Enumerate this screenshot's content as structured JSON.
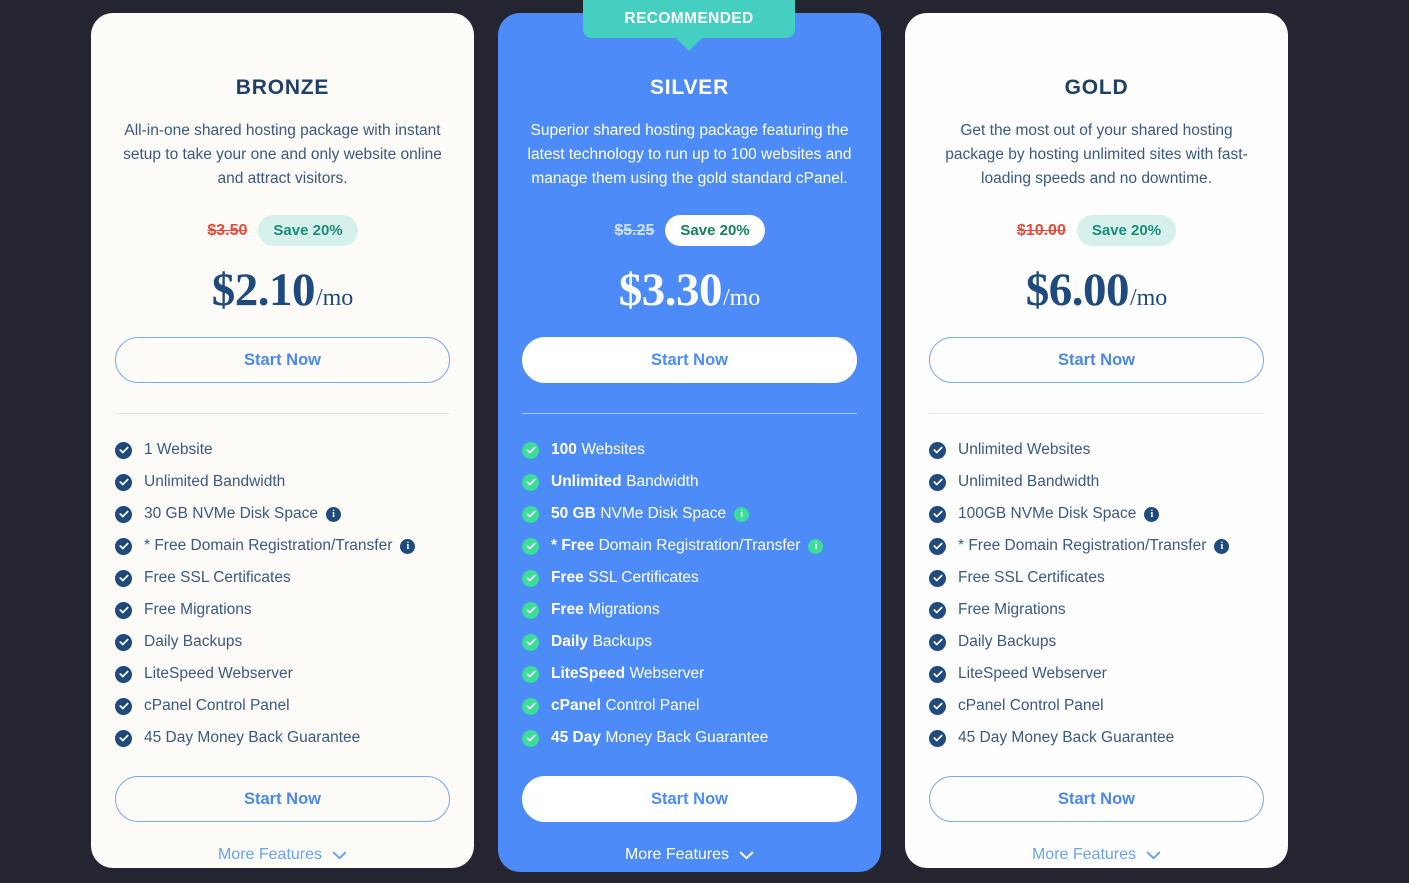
{
  "ribbon": {
    "label": "RECOMMENDED"
  },
  "colors": {
    "page_background": "#252532",
    "bronze_card": "#fdfbf7",
    "silver_card": "#4d8cf8",
    "gold_card": "#fefefe",
    "ribbon_teal": "#44cfc0",
    "accent_blue": "#4a89e8",
    "navy_text": "#1f4a7d",
    "old_price_red": "#e8493a",
    "save_pill_bg": "#d6f1ec",
    "save_pill_text": "#1c8a78",
    "check_green": "#3ddc9a"
  },
  "plans": [
    {
      "id": "bronze",
      "title": "BRONZE",
      "description": "All-in-one shared hosting package with instant setup to take your one and only website online and attract visitors.",
      "old_price": "$3.50",
      "save_badge": "Save 20%",
      "price": "$2.10",
      "period": "/mo",
      "cta_top": "Start Now",
      "cta_bottom": "Start Now",
      "more_features": "More Features",
      "features": [
        {
          "strong": "",
          "text": "1 Website",
          "info": false
        },
        {
          "strong": "",
          "text": "Unlimited Bandwidth",
          "info": false
        },
        {
          "strong": "",
          "text": "30 GB NVMe Disk Space",
          "info": true
        },
        {
          "strong": "",
          "text": "* Free Domain Registration/Transfer",
          "info": true
        },
        {
          "strong": "",
          "text": "Free SSL Certificates",
          "info": false
        },
        {
          "strong": "",
          "text": "Free Migrations",
          "info": false
        },
        {
          "strong": "",
          "text": "Daily Backups",
          "info": false
        },
        {
          "strong": "",
          "text": "LiteSpeed Webserver",
          "info": false
        },
        {
          "strong": "",
          "text": "cPanel Control Panel",
          "info": false
        },
        {
          "strong": "",
          "text": "45 Day Money Back Guarantee",
          "info": false
        }
      ]
    },
    {
      "id": "silver",
      "title": "SILVER",
      "description": "Superior shared hosting package featuring the latest technology to run up to 100 websites and manage them using the gold standard cPanel.",
      "old_price": "$5.25",
      "save_badge": "Save 20%",
      "price": "$3.30",
      "period": "/mo",
      "cta_top": "Start Now",
      "cta_bottom": "Start Now",
      "more_features": "More Features",
      "features": [
        {
          "strong": "100",
          "text": "Websites",
          "info": false
        },
        {
          "strong": "Unlimited",
          "text": "Bandwidth",
          "info": false
        },
        {
          "strong": "50 GB",
          "text": "NVMe Disk Space",
          "info": true
        },
        {
          "strong": "* Free",
          "text": "Domain Registration/Transfer",
          "info": true
        },
        {
          "strong": "Free",
          "text": "SSL Certificates",
          "info": false
        },
        {
          "strong": "Free",
          "text": "Migrations",
          "info": false
        },
        {
          "strong": "Daily",
          "text": "Backups",
          "info": false
        },
        {
          "strong": "LiteSpeed",
          "text": "Webserver",
          "info": false
        },
        {
          "strong": "cPanel",
          "text": "Control Panel",
          "info": false
        },
        {
          "strong": "45 Day",
          "text": "Money Back Guarantee",
          "info": false
        }
      ]
    },
    {
      "id": "gold",
      "title": "GOLD",
      "description": "Get the most out of your shared hosting package by hosting unlimited sites with fast-loading speeds and no downtime.",
      "old_price": "$10.00",
      "save_badge": "Save 20%",
      "price": "$6.00",
      "period": "/mo",
      "cta_top": "Start Now",
      "cta_bottom": "Start Now",
      "more_features": "More Features",
      "features": [
        {
          "strong": "",
          "text": "Unlimited Websites",
          "info": false
        },
        {
          "strong": "",
          "text": "Unlimited Bandwidth",
          "info": false
        },
        {
          "strong": "",
          "text": "100GB NVMe Disk Space",
          "info": true
        },
        {
          "strong": "",
          "text": "* Free Domain Registration/Transfer",
          "info": true
        },
        {
          "strong": "",
          "text": "Free SSL Certificates",
          "info": false
        },
        {
          "strong": "",
          "text": "Free Migrations",
          "info": false
        },
        {
          "strong": "",
          "text": "Daily Backups",
          "info": false
        },
        {
          "strong": "",
          "text": "LiteSpeed Webserver",
          "info": false
        },
        {
          "strong": "",
          "text": "cPanel Control Panel",
          "info": false
        },
        {
          "strong": "",
          "text": "45 Day Money Back Guarantee",
          "info": false
        }
      ]
    }
  ],
  "icons": {
    "check": "check-icon",
    "info": "info-icon",
    "chevron": "chevron-down-icon",
    "info_glyph": "i"
  }
}
